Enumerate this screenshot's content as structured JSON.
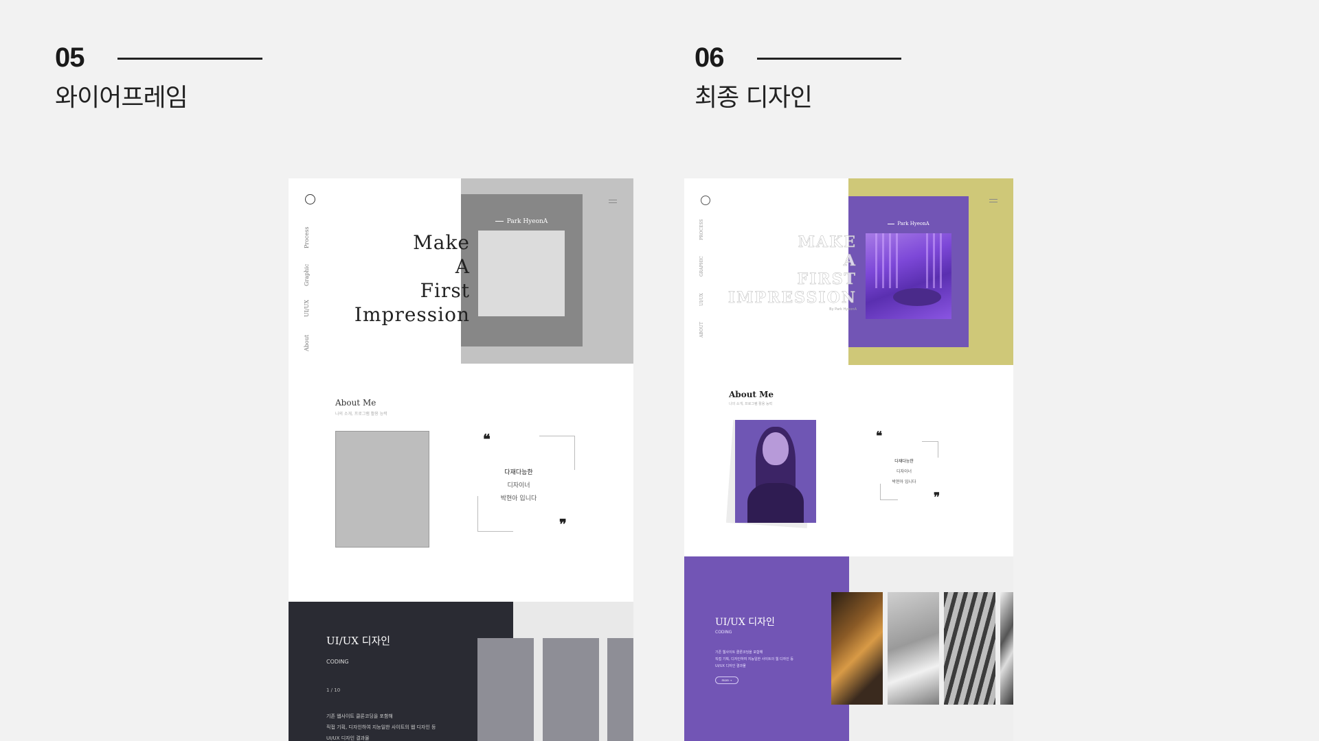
{
  "sections": [
    {
      "number": "05",
      "title": "와이어프레임"
    },
    {
      "number": "06",
      "title": "최종 디자인"
    }
  ],
  "wireframe": {
    "hero": {
      "name": "Park HyeonA",
      "headline": [
        "Make",
        "A",
        "First",
        "Impression"
      ]
    },
    "nav": [
      "Process",
      "Graphic",
      "UI/UX",
      "About"
    ],
    "about": {
      "title": "About Me",
      "subtitle": "나의 소개, 프로그램 활용 능력",
      "quote_lines": [
        "다재다능한",
        "디자이너",
        "박현아 입니다"
      ]
    },
    "project_card": {
      "title": "UI/UX 디자인",
      "subtitle": "CODING",
      "page": "1 / 10",
      "description_lines": [
        "기존 웹사이트 클론코딩을 포함해",
        "직접 기획, 디자인하여 지능일한 사이트의 웹 디자인 등",
        "UI/UX 디자인 결과물"
      ]
    }
  },
  "final_design": {
    "hero": {
      "name": "Park HyeonA",
      "headline": [
        "MAKE",
        "A",
        "FIRST",
        "IMPRESSION"
      ],
      "byline": "By Park HyeonA"
    },
    "nav": [
      "PROCESS",
      "GRAPHIC",
      "UI/UX",
      "ABOUT"
    ],
    "about": {
      "title": "About Me",
      "subtitle": "나의 소개, 프로그램 활용 능력",
      "quote_lines": [
        "다재다능한",
        "디자이너",
        "박현아 입니다"
      ]
    },
    "project_card": {
      "title": "UI/UX 디자인",
      "subtitle": "CODING",
      "description_lines": [
        "기존 웹사이트 클론코딩을 포함해",
        "직접 기획, 디자인하여 지능일한 사이트의 웹 디자인 등",
        "UI/UX 디자인 결과물"
      ],
      "button": "more →"
    }
  },
  "colors": {
    "page_bg": "#f2f2f2",
    "wire_gray": "#878787",
    "final_purple": "#7255b5",
    "final_olive": "#cfc878",
    "wire_dark_panel": "#2a2b33"
  }
}
